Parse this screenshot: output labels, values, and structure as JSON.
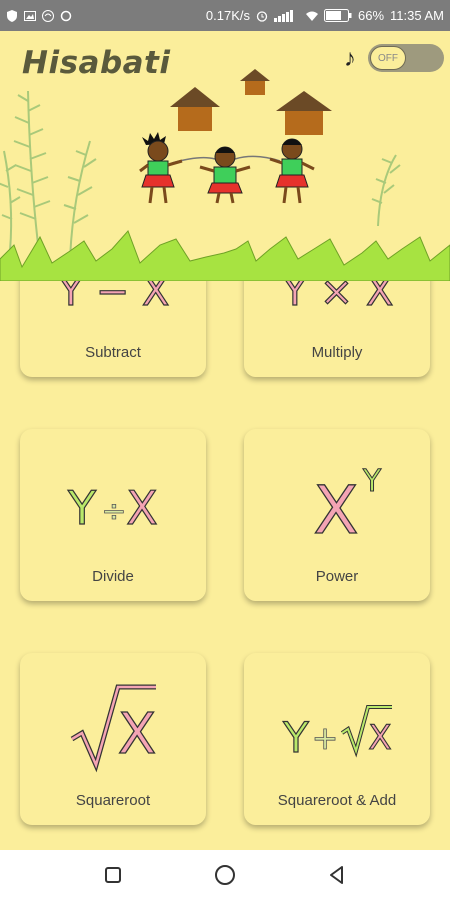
{
  "status_bar": {
    "network_speed": "0.17K/s",
    "battery_percent": "66%",
    "time": "11:35 AM",
    "icons": [
      "shield-icon",
      "image-icon",
      "wifi-calling-icon",
      "sync-icon",
      "alarm-icon",
      "signal-icon",
      "wifi-icon",
      "battery-icon"
    ]
  },
  "header": {
    "title": "Hisabati",
    "music_icon": "music-note-icon",
    "toggle_label": "OFF"
  },
  "cards": [
    {
      "label": "Subtract",
      "symbol": "Y − X"
    },
    {
      "label": "Multiply",
      "symbol": "Y × X"
    },
    {
      "label": "Divide",
      "symbol_left": "Y",
      "symbol_op": "÷",
      "symbol_right": "X"
    },
    {
      "label": "Power",
      "symbol_base": "X",
      "symbol_exp": "Y"
    },
    {
      "label": "Squareroot",
      "symbol_radicand": "X"
    },
    {
      "label": "Squareroot & Add",
      "symbol_left": "Y",
      "symbol_op": "+",
      "symbol_radicand": "X"
    }
  ],
  "nav": {
    "square": "recent-apps-icon",
    "circle": "home-icon",
    "triangle": "back-icon"
  },
  "colors": {
    "background": "#fbee9b",
    "y_color": "#b9e86a",
    "x_color": "#f4a4b4",
    "status_bar": "#7c7c7c"
  }
}
